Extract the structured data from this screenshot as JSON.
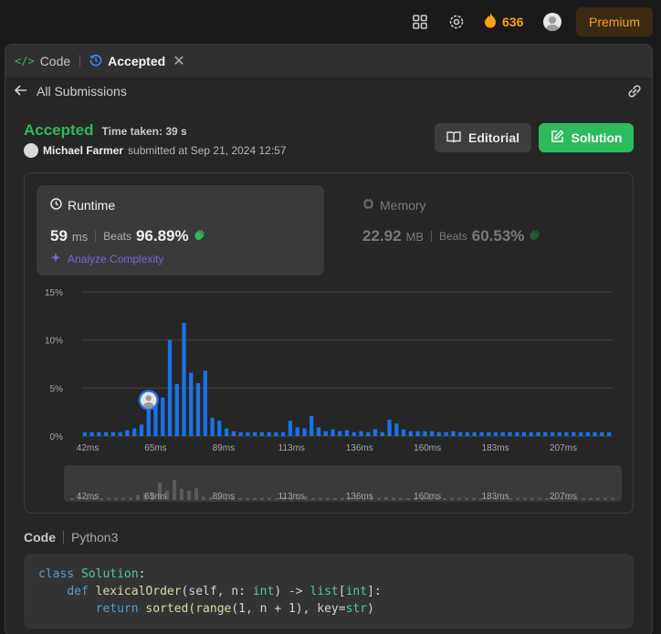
{
  "topbar": {
    "streak_count": "636",
    "premium_label": "Premium"
  },
  "tabs": [
    {
      "label": "Code",
      "active": false
    },
    {
      "label": "Accepted",
      "active": true
    }
  ],
  "subbar": {
    "back_label": "All Submissions"
  },
  "submission": {
    "status": "Accepted",
    "time_taken": "Time taken: 39 s",
    "user_name": "Michael Farmer",
    "submitted_text": "submitted at Sep 21, 2024 12:57"
  },
  "buttons": {
    "editorial": "Editorial",
    "solution": "Solution"
  },
  "runtime": {
    "title": "Runtime",
    "value": "59",
    "unit": "ms",
    "beats_label": "Beats",
    "beats_value": "96.89%",
    "analyze_label": "Analyze Complexity"
  },
  "memory": {
    "title": "Memory",
    "value": "22.92",
    "unit": "MB",
    "beats_label": "Beats",
    "beats_value": "60.53%"
  },
  "colors": {
    "accent_green": "#2cbb5d",
    "bar_blue": "#1a73e8",
    "premium_orange": "#ffa116"
  },
  "chart_data": {
    "type": "bar",
    "x_tick_labels": [
      "42ms",
      "65ms",
      "89ms",
      "113ms",
      "136ms",
      "160ms",
      "183ms",
      "207ms"
    ],
    "y_tick_labels": [
      "15%",
      "10%",
      "5%",
      "0%"
    ],
    "ylim": [
      0,
      15
    ],
    "values": [
      0.4,
      0.4,
      0.4,
      0.4,
      0.4,
      0.4,
      0.6,
      0.8,
      1.2,
      2.8,
      3.7,
      4.0,
      10.0,
      5.4,
      11.8,
      6.6,
      5.5,
      6.8,
      1.9,
      1.6,
      0.8,
      0.5,
      0.4,
      0.4,
      0.4,
      0.4,
      0.4,
      0.4,
      0.4,
      1.6,
      0.9,
      0.8,
      2.1,
      0.9,
      0.5,
      0.7,
      0.5,
      0.6,
      0.4,
      0.5,
      0.4,
      0.7,
      0.4,
      1.7,
      1.3,
      0.7,
      0.5,
      0.5,
      0.5,
      0.5,
      0.4,
      0.4,
      0.5,
      0.4,
      0.4,
      0.4,
      0.4,
      0.4,
      0.4,
      0.4,
      0.4,
      0.4,
      0.4,
      0.4,
      0.4,
      0.4,
      0.4,
      0.4,
      0.4,
      0.4,
      0.4,
      0.4,
      0.4,
      0.4,
      0.4
    ],
    "highlight_index": 9,
    "grid": true
  },
  "code": {
    "label": "Code",
    "language": "Python3",
    "lines": [
      "class Solution:",
      "    def lexicalOrder(self, n: int) -> list[int]:",
      "        return sorted(range(1, n + 1), key=str)"
    ]
  }
}
